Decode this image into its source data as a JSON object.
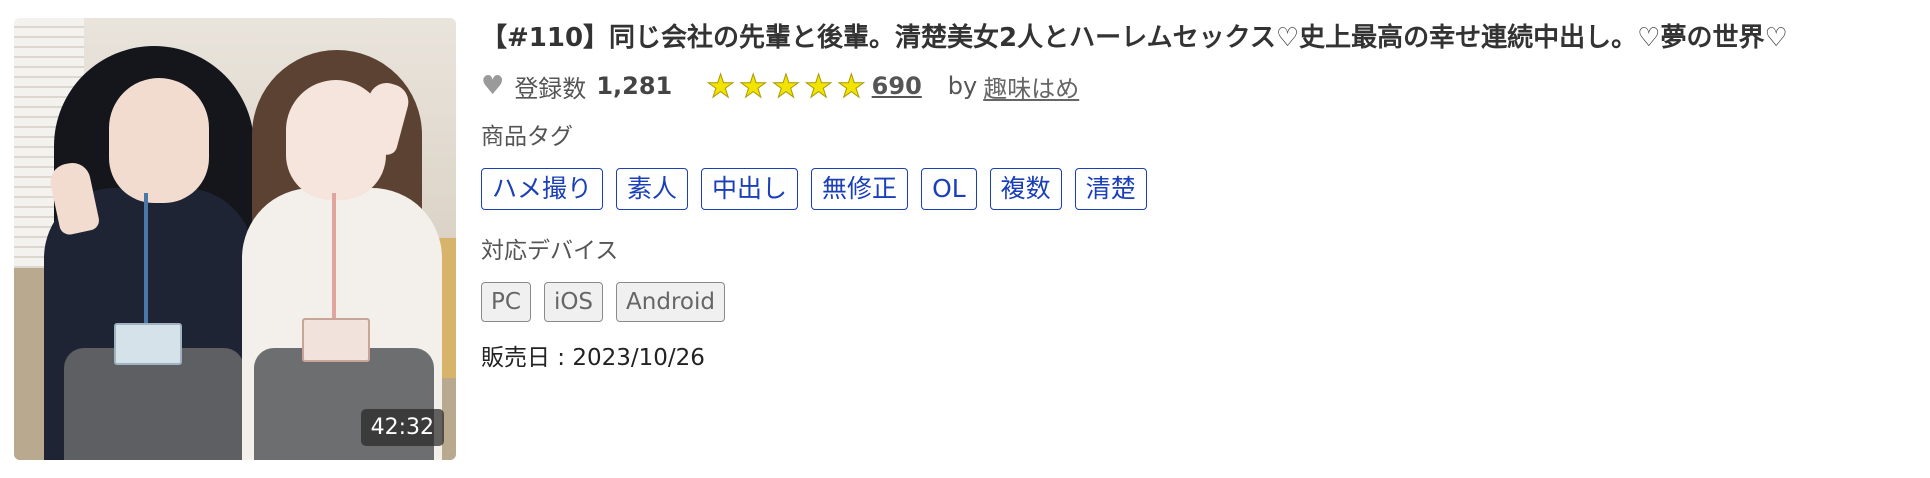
{
  "thumbnail": {
    "duration": "42:32"
  },
  "product": {
    "title": "【#110】同じ会社の先輩と後輩。清楚美女2人とハーレムセックス♡史上最高の幸せ連続中出し。♡夢の世界♡",
    "registration_label": "登録数",
    "registration_count": "1,281",
    "rating_stars": 5,
    "review_count": "690",
    "by_label": "by",
    "author": "趣味はめ"
  },
  "tags_section": {
    "label": "商品タグ",
    "tags": [
      "ハメ撮り",
      "素人",
      "中出し",
      "無修正",
      "OL",
      "複数",
      "清楚"
    ]
  },
  "devices_section": {
    "label": "対応デバイス",
    "devices": [
      "PC",
      "iOS",
      "Android"
    ]
  },
  "release": {
    "text": "販売日 : 2023/10/26"
  },
  "icons": {
    "heart": "heart-icon",
    "star": "star-icon"
  },
  "colors": {
    "tag_text": "#1a3fb8",
    "star_fill": "#f3e300"
  }
}
